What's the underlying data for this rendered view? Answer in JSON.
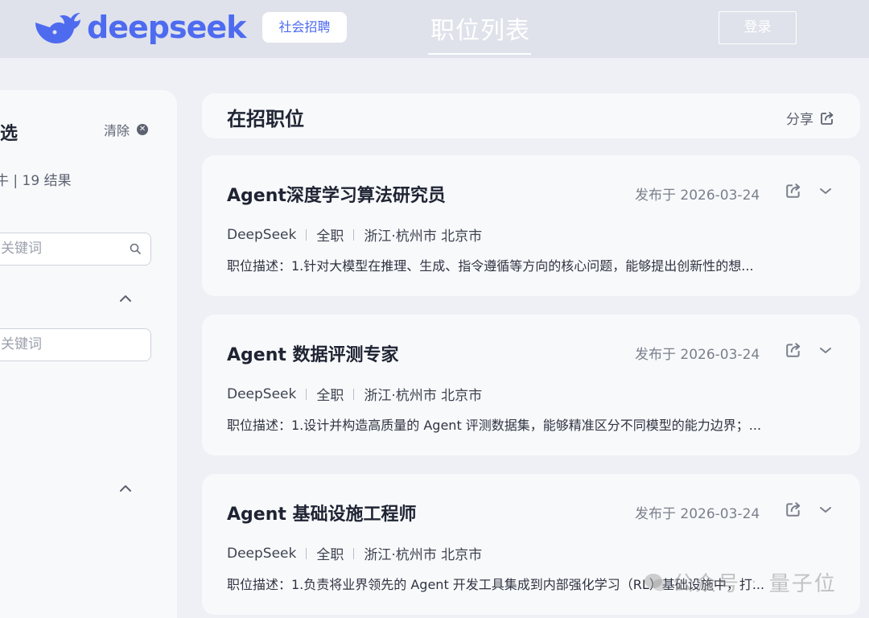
{
  "header": {
    "logo_text": "deepseek",
    "recruit_badge": "社会招聘",
    "nav_title": "职位列表",
    "login_label": "登录"
  },
  "sidebar": {
    "filter_title": "选",
    "clear_label": "清除",
    "result_summary": "牛 | 19 结果",
    "keyword_input_1": {
      "placeholder": "关键词"
    },
    "keyword_input_2": {
      "placeholder": "关键词"
    }
  },
  "main": {
    "section_title": "在招职位",
    "share_label": "分享",
    "jobs": [
      {
        "title": "Agent深度学习算法研究员",
        "date": "发布于 2026-03-24",
        "company": "DeepSeek",
        "type": "全职",
        "location": "浙江·杭州市 北京市",
        "description": "职位描述：1.针对大模型在推理、生成、指令遵循等方向的核心问题，能够提出创新性的想..."
      },
      {
        "title": "Agent 数据评测专家",
        "date": "发布于 2026-03-24",
        "company": "DeepSeek",
        "type": "全职",
        "location": "浙江·杭州市 北京市",
        "description": "职位描述：1.设计并构造高质量的 Agent 评测数据集，能够精准区分不同模型的能力边界；..."
      },
      {
        "title": "Agent 基础设施工程师",
        "date": "发布于 2026-03-24",
        "company": "DeepSeek",
        "type": "全职",
        "location": "浙江·杭州市 北京市",
        "description": "职位描述：1.负责将业界领先的 Agent 开发工具集成到内部强化学习（RL）基础设施中，打..."
      }
    ]
  },
  "watermark": {
    "left": "公众号",
    "right": "量子位"
  },
  "colors": {
    "brand": "#4e6bf0",
    "header_bg": "#dfe2ea",
    "page_bg": "#eef0f5",
    "card_bg": "#f8f9fb"
  }
}
